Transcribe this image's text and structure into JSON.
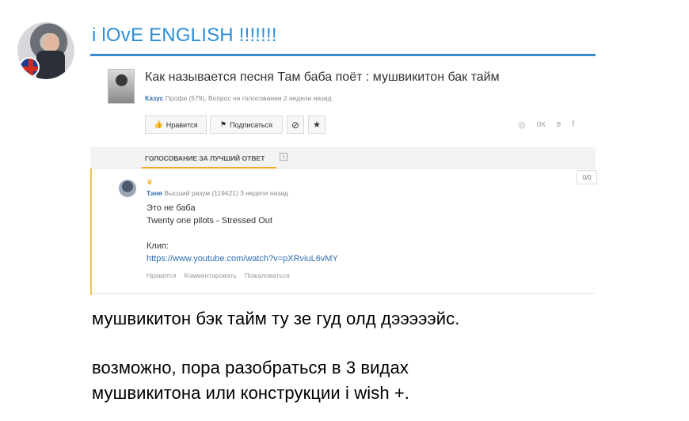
{
  "post": {
    "channel_name": "i lOvE ENGLISH !!!!!!!",
    "avatar_icon": "channel-avatar-icon",
    "message_lines": [
      "мушвикитон бэк тайм ту зе гуд олд дэээээйс.",
      "возможно, пора разобраться в 3 видах",
      "мушвикитона или конструкции i wish +."
    ]
  },
  "screenshot": {
    "question_title": "Как называется песня Там баба поёт : мушвикитон бак тайм",
    "question_author": "Казус",
    "question_meta": "Профи (579), Вопрос на голосовании 2 недели назад",
    "buttons": {
      "like": "Нравится",
      "subscribe": "Подписаться",
      "block": "⊘",
      "star": "★"
    },
    "socials": [
      "◎",
      "ок",
      "в",
      "f"
    ],
    "vote_label": "ГОЛОСОВАНИЕ ЗА ЛУЧШИЙ ОТВЕТ",
    "vote_info": "i",
    "counter": "0/0",
    "answer": {
      "author": "Таня",
      "meta": "Высший разум (119421) 3 недели назад",
      "lines": [
        "Это не баба",
        "Twenty one pilots - Stressed Out",
        "Клип:"
      ],
      "link": "https://www.youtube.com/watch?v=pXRviuL6vMY",
      "actions": [
        "Нравится",
        "Комментировать",
        "Пожаловаться"
      ]
    }
  },
  "colors": {
    "channel_name": "#2b8ed6",
    "card_top_border": "#3d8ad3",
    "link": "#2f6db3",
    "accent_orange": "#f3a928"
  }
}
